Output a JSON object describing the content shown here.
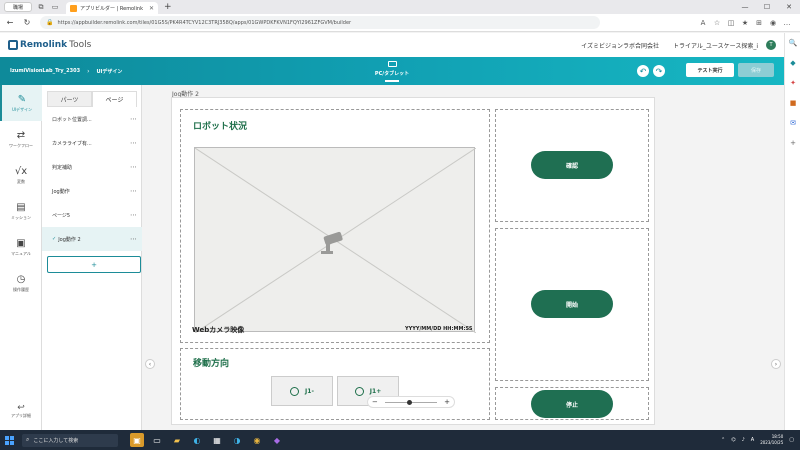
{
  "browser": {
    "profile_label": "職場",
    "tab_title": "アプリビルダー | Remolink",
    "url": "https://appbuilder.remolink.com/tiles/01G5S/PK4R4TCYV12C3TRJ358Q/apps/01GWPDKFKVN1FQYI2961ZFGVM/builder"
  },
  "app": {
    "logo": "Remolink",
    "logo_suffix": "Tools",
    "company": "イズミビジョンラボ合同会社",
    "user": "トライアル_ユースケース探索_i",
    "avatar": "T",
    "project": "IzumiVisionLab_Try_2303",
    "crumb": "UIデザイン",
    "device": "PC/タブレット",
    "run_label": "テスト実行",
    "save_label": "保存"
  },
  "rail": {
    "items": [
      {
        "label": "UIデザイン"
      },
      {
        "label": "ワークフロー"
      },
      {
        "label": "変数"
      },
      {
        "label": "ミッション"
      },
      {
        "label": "マニュアル"
      },
      {
        "label": "操作履歴"
      }
    ],
    "bottom_label": "アプリ詳細"
  },
  "panel": {
    "tab_parts": "パーツ",
    "tab_pages": "ページ",
    "pages": [
      {
        "name": "ロボット位置調..."
      },
      {
        "name": "カメラライブ有..."
      },
      {
        "name": "判定補助"
      },
      {
        "name": "Jog動作"
      },
      {
        "name": "ページ5"
      },
      {
        "name": "Jog動作 2"
      }
    ],
    "add_label": "+"
  },
  "canvas": {
    "title": "Jog動作 2",
    "robot_status_title": "ロボット状況",
    "camera_label": "Webカメラ映像",
    "camera_timestamp": "YYYY/MM/DD HH:MM:SS",
    "move_title": "移動方向",
    "jog_minus": "J1-",
    "jog_plus": "J1+",
    "confirm_label": "確認",
    "start_label": "開始",
    "stop_label": "停止"
  },
  "taskbar": {
    "search_placeholder": "ここに入力して検索",
    "time": "18:50",
    "date": "2023/10/25",
    "ime": "A"
  }
}
